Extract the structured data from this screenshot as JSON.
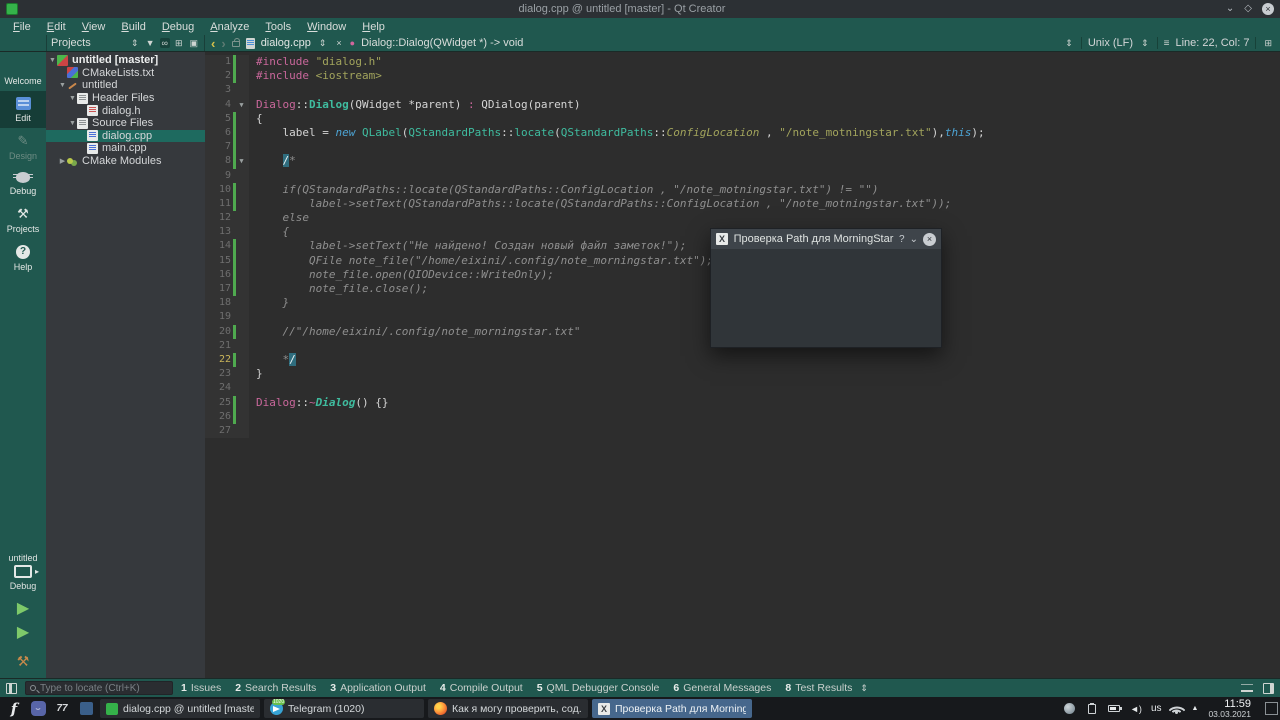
{
  "window": {
    "title": "dialog.cpp @ untitled [master] - Qt Creator",
    "controls": {
      "minimize": "⌄",
      "maximize": "◇",
      "close": "×"
    }
  },
  "menubar": {
    "items": [
      "File",
      "Edit",
      "View",
      "Build",
      "Debug",
      "Analyze",
      "Tools",
      "Window",
      "Help"
    ]
  },
  "toolbar": {
    "projects_label": "Projects",
    "breadcrumb_file": "dialog.cpp",
    "symbol": "Dialog::Dialog(QWidget *) -> void",
    "line_ending": "Unix (LF)",
    "cursor_pos": "Line: 22, Col: 7"
  },
  "modebar": {
    "items": [
      {
        "label": "Welcome",
        "icon": "grid-icon",
        "state": "normal"
      },
      {
        "label": "Edit",
        "icon": "edit-icon",
        "state": "selected"
      },
      {
        "label": "Design",
        "icon": "pencil-icon",
        "state": "disabled"
      },
      {
        "label": "Debug",
        "icon": "bug-icon",
        "state": "normal"
      },
      {
        "label": "Projects",
        "icon": "wrench-icon",
        "state": "normal"
      },
      {
        "label": "Help",
        "icon": "help-icon",
        "state": "normal"
      }
    ],
    "target": {
      "project": "untitled",
      "config": "Debug"
    }
  },
  "project_tree": {
    "items": [
      {
        "label": "untitled [master]",
        "level": 0,
        "icon": "qt-project-icon",
        "expander": "down",
        "bold": true,
        "selected": false
      },
      {
        "label": "CMakeLists.txt",
        "level": 1,
        "icon": "cmake-file-icon",
        "expander": "none",
        "bold": false,
        "selected": false
      },
      {
        "label": "untitled",
        "level": 1,
        "icon": "wrench-file-icon",
        "expander": "down",
        "bold": false,
        "selected": false
      },
      {
        "label": "Header Files",
        "level": 2,
        "icon": "folder-icon",
        "expander": "down",
        "bold": false,
        "selected": false
      },
      {
        "label": "dialog.h",
        "level": 3,
        "icon": "header-file-icon",
        "expander": "none",
        "bold": false,
        "selected": false
      },
      {
        "label": "Source Files",
        "level": 2,
        "icon": "folder-icon",
        "expander": "down",
        "bold": false,
        "selected": false
      },
      {
        "label": "dialog.cpp",
        "level": 3,
        "icon": "cpp-file-icon",
        "expander": "none",
        "bold": false,
        "selected": true
      },
      {
        "label": "main.cpp",
        "level": 3,
        "icon": "cpp-file-icon",
        "expander": "none",
        "bold": false,
        "selected": false
      },
      {
        "label": "CMake Modules",
        "level": 1,
        "icon": "cmake-modules-icon",
        "expander": "right",
        "bold": false,
        "selected": false
      }
    ]
  },
  "editor": {
    "current_line": 22,
    "changed_lines": [
      1,
      2,
      5,
      6,
      7,
      8,
      10,
      11,
      14,
      15,
      16,
      17,
      20,
      22,
      25,
      26
    ],
    "fold_lines": [
      4,
      8
    ],
    "lines": [
      {
        "n": 1,
        "segs": [
          [
            "pp",
            "#include "
          ],
          [
            "str",
            "\"dialog.h\""
          ]
        ]
      },
      {
        "n": 2,
        "segs": [
          [
            "pp",
            "#include "
          ],
          [
            "str",
            "<iostream>"
          ]
        ]
      },
      {
        "n": 3,
        "segs": []
      },
      {
        "n": 4,
        "segs": [
          [
            "pp",
            "Dialog"
          ],
          [
            "pl",
            "::"
          ],
          [
            "ctor",
            "Dialog"
          ],
          [
            "pl",
            "(QWidget *parent) "
          ],
          [
            "pp",
            ":"
          ],
          [
            "pl",
            " QDialog(parent)"
          ]
        ]
      },
      {
        "n": 5,
        "segs": [
          [
            "pl",
            "{"
          ]
        ]
      },
      {
        "n": 6,
        "segs": [
          [
            "pl",
            "    label = "
          ],
          [
            "kw",
            "new"
          ],
          [
            "pl",
            " "
          ],
          [
            "typ",
            "QLabel"
          ],
          [
            "pl",
            "("
          ],
          [
            "typ",
            "QStandardPaths"
          ],
          [
            "pl",
            "::"
          ],
          [
            "typ",
            "locate"
          ],
          [
            "pl",
            "("
          ],
          [
            "typ",
            "QStandardPaths"
          ],
          [
            "pl",
            "::"
          ],
          [
            "enm",
            "ConfigLocation"
          ],
          [
            "pl",
            " , "
          ],
          [
            "str",
            "\"/note_motningstar.txt\""
          ],
          [
            "pl",
            "),"
          ],
          [
            "kw",
            "this"
          ],
          [
            "pl",
            ");"
          ]
        ]
      },
      {
        "n": 7,
        "segs": []
      },
      {
        "n": 8,
        "segs": [
          [
            "pl",
            "    "
          ],
          [
            "hl",
            "/"
          ],
          [
            "cmt",
            "*"
          ]
        ]
      },
      {
        "n": 9,
        "segs": []
      },
      {
        "n": 10,
        "segs": [
          [
            "cmt",
            "    if(QStandardPaths::locate(QStandardPaths::ConfigLocation , \"/note_motningstar.txt\") != \"\")"
          ]
        ]
      },
      {
        "n": 11,
        "segs": [
          [
            "cmt",
            "        label->setText(QStandardPaths::locate(QStandardPaths::ConfigLocation , \"/note_motningstar.txt\"));"
          ]
        ]
      },
      {
        "n": 12,
        "segs": [
          [
            "cmt",
            "    else"
          ]
        ]
      },
      {
        "n": 13,
        "segs": [
          [
            "cmt",
            "    {"
          ]
        ]
      },
      {
        "n": 14,
        "segs": [
          [
            "cmt",
            "        label->setText(\"Не найдено! Создан новый файл заметок!\");"
          ]
        ]
      },
      {
        "n": 15,
        "segs": [
          [
            "cmt",
            "        QFile note_file(\"/home/eixini/.config/note_morningstar.txt\");"
          ]
        ]
      },
      {
        "n": 16,
        "segs": [
          [
            "cmt",
            "        note_file.open(QIODevice::WriteOnly);"
          ]
        ]
      },
      {
        "n": 17,
        "segs": [
          [
            "cmt",
            "        note_file.close();"
          ]
        ]
      },
      {
        "n": 18,
        "segs": [
          [
            "cmt",
            "    }"
          ]
        ]
      },
      {
        "n": 19,
        "segs": []
      },
      {
        "n": 20,
        "segs": [
          [
            "cmt",
            "    //\"/home/eixini/.config/note_morningstar.txt\""
          ]
        ]
      },
      {
        "n": 21,
        "segs": []
      },
      {
        "n": 22,
        "segs": [
          [
            "cmt",
            "    *"
          ],
          [
            "hl",
            "/"
          ]
        ]
      },
      {
        "n": 23,
        "segs": [
          [
            "pl",
            "}"
          ]
        ]
      },
      {
        "n": 24,
        "segs": []
      },
      {
        "n": 25,
        "segs": [
          [
            "pp",
            "Dialog"
          ],
          [
            "pl",
            "::"
          ],
          [
            "pp",
            "~"
          ],
          [
            "dtor",
            "Dialog"
          ],
          [
            "pl",
            "() {}"
          ]
        ]
      },
      {
        "n": 26,
        "segs": []
      },
      {
        "n": 27,
        "segs": []
      }
    ]
  },
  "float_dialog": {
    "title": "Проверка Path для MorningStar",
    "help_button": "?",
    "shade_button": "⌄",
    "close_button": "×",
    "app_icon_glyph": "X"
  },
  "locator": {
    "placeholder": "Type to locate (Ctrl+K)"
  },
  "output_panes": [
    {
      "num": "1",
      "label": "Issues"
    },
    {
      "num": "2",
      "label": "Search Results"
    },
    {
      "num": "3",
      "label": "Application Output"
    },
    {
      "num": "4",
      "label": "Compile Output"
    },
    {
      "num": "5",
      "label": "QML Debugger Console"
    },
    {
      "num": "6",
      "label": "General Messages"
    },
    {
      "num": "8",
      "label": "Test Results"
    }
  ],
  "taskbar": {
    "launchers": [
      {
        "name": "fedora-menu-icon",
        "glyph": "f"
      },
      {
        "name": "discord-icon",
        "glyph": ""
      },
      {
        "name": "app-icon",
        "glyph": "77"
      },
      {
        "name": "app-icon-2",
        "glyph": ""
      }
    ],
    "windows": [
      {
        "label": "dialog.cpp @ untitled [maste...",
        "icon": "qtcreator-icon",
        "active": false
      },
      {
        "label": "Telegram (1020)",
        "icon": "telegram-icon",
        "active": false,
        "badge": "1020"
      },
      {
        "label": "Как я могу проверить, сод...",
        "icon": "firefox-icon",
        "active": false
      },
      {
        "label": "Проверка Path для Morning...",
        "icon": "x-app-icon",
        "active": true
      }
    ],
    "keyboard_layout": "us",
    "clock": {
      "time": "11:59",
      "date": "03.03.2021"
    }
  },
  "colors": {
    "teal_bar": "#20584f",
    "editor_bg": "#2d2d2d",
    "selection_teal": "#1e6a5f",
    "active_task_blue": "#46678c",
    "change_bar_green": "#4faa4f",
    "string_olive": "#a2a45c",
    "type_teal": "#3fbc9f",
    "preproc_pink": "#c9679b",
    "keyword_blue": "#4da4d4",
    "comment_gray": "#8f8f8f"
  }
}
